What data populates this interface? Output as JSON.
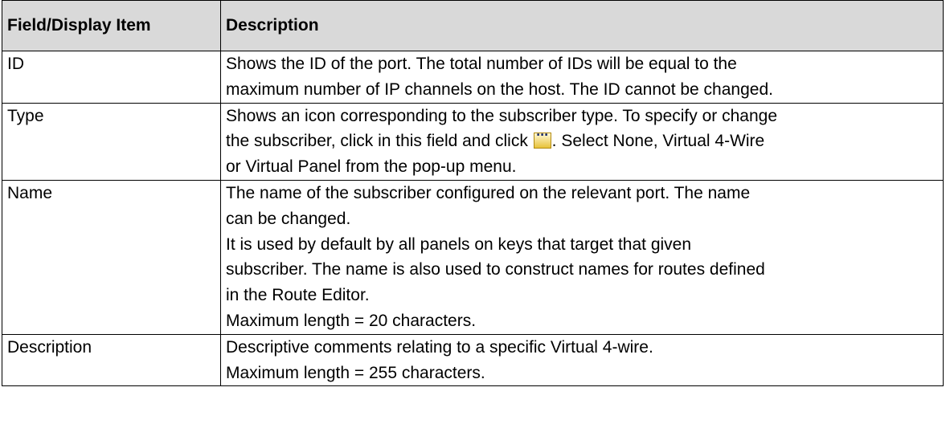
{
  "table": {
    "headers": [
      "Field/Display Item",
      "Description"
    ],
    "rows": [
      {
        "field": "ID",
        "lines": [
          "Shows the ID of the port. The total number of IDs will be equal to the",
          "maximum number of IP channels on the host. The ID cannot be changed."
        ]
      },
      {
        "field": "Type",
        "line1": "Shows an icon corresponding to the subscriber type. To specify or change",
        "line2_before": "the subscriber, click in this field and click ",
        "line2_after": ". Select None, Virtual 4-Wire",
        "line3": "or Virtual Panel from the pop-up menu.",
        "button_icon": "ellipsis-button-icon"
      },
      {
        "field": "Name",
        "lines": [
          "The name of the subscriber configured on the relevant port. The name",
          "can be changed.",
          "It is used by default by all panels on keys that target that given",
          "subscriber. The name is also used to construct names for routes defined",
          "in the Route Editor.",
          "Maximum length = 20 characters."
        ]
      },
      {
        "field": "Description",
        "lines": [
          "Descriptive comments relating to a specific Virtual 4-wire.",
          "Maximum length = 255 characters."
        ]
      }
    ]
  }
}
